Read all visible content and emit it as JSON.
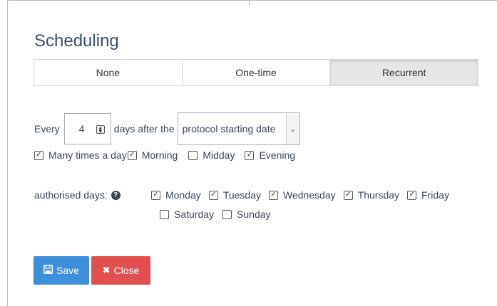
{
  "title": "Scheduling",
  "tabs": [
    {
      "label": "None",
      "active": false
    },
    {
      "label": "One-time",
      "active": false
    },
    {
      "label": "Recurrent",
      "active": true
    }
  ],
  "recurrence": {
    "every_label": "Every",
    "interval_value": "4",
    "days_after_label": "days after the",
    "reference_selected": "protocol starting date"
  },
  "times": {
    "many_times": {
      "label": "Many times a day",
      "checked": true
    },
    "morning": {
      "label": "Morning",
      "checked": true
    },
    "midday": {
      "label": "Midday",
      "checked": false
    },
    "evening": {
      "label": "Evening",
      "checked": true
    }
  },
  "authorised_days": {
    "label": "authorised days:",
    "days": [
      {
        "label": "Monday",
        "checked": true
      },
      {
        "label": "Tuesday",
        "checked": true
      },
      {
        "label": "Wednesday",
        "checked": true
      },
      {
        "label": "Thursday",
        "checked": true
      },
      {
        "label": "Friday",
        "checked": true
      },
      {
        "label": "Saturday",
        "checked": false
      },
      {
        "label": "Sunday",
        "checked": false
      }
    ]
  },
  "actions": {
    "save_label": "Save",
    "close_label": "Close"
  },
  "colors": {
    "save": "#3d8fd9",
    "close": "#e05050",
    "active_tab": "#e6e6e6"
  }
}
